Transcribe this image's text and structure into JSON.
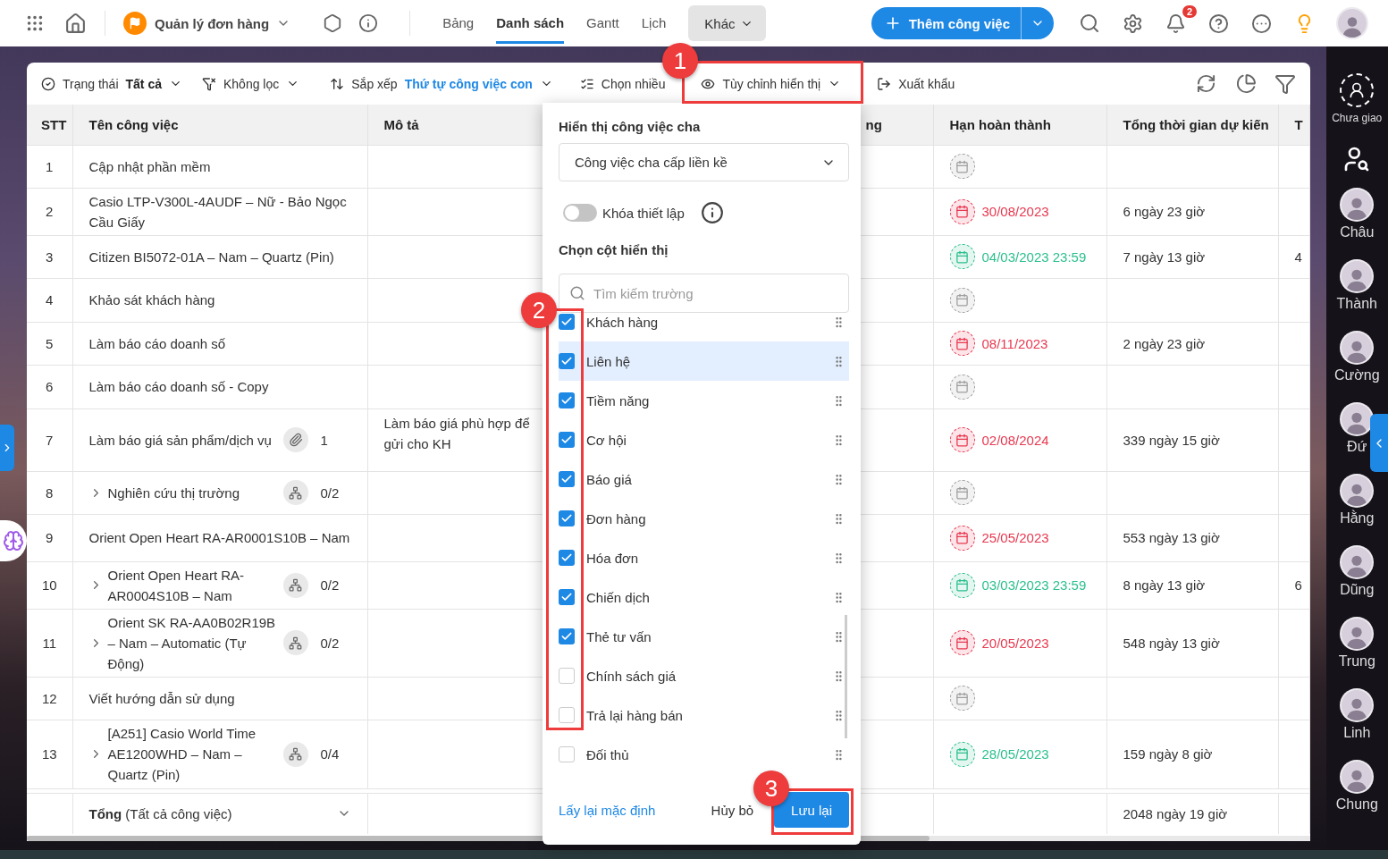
{
  "topbar": {
    "project": {
      "name": "Quản lý đơn hàng"
    },
    "views": [
      {
        "label": "Bảng",
        "selected": false
      },
      {
        "label": "Danh sách",
        "selected": true
      },
      {
        "label": "Gantt",
        "selected": false
      },
      {
        "label": "Lịch",
        "selected": false
      }
    ],
    "more_menu": {
      "label": "Khác"
    },
    "add_button": {
      "label": "Thêm công việc"
    },
    "notifications": {
      "count": "2"
    }
  },
  "toolbar": {
    "status": {
      "label": "Trạng thái",
      "value": "Tất cả"
    },
    "filter": {
      "label": "Không lọc"
    },
    "sort": {
      "label": "Sắp xếp",
      "value": "Thứ tự công việc con"
    },
    "multi_select": {
      "label": "Chọn nhiều"
    },
    "customize": {
      "label": "Tùy chỉnh hiển thị"
    },
    "export": {
      "label": "Xuất khẩu"
    }
  },
  "table": {
    "columns": [
      "STT",
      "Tên công việc",
      "Mô tả",
      "ng",
      "Hạn hoàn thành",
      "Tổng thời gian dự kiến",
      "T"
    ],
    "rows": [
      {
        "stt": "1",
        "name": "Cập nhật phần mềm",
        "expander": false,
        "deadline": {
          "color": "#9e9e9e"
        }
      },
      {
        "stt": "2",
        "name": "Casio LTP-V300L-4AUDF – Nữ  - Bảo Ngọc Cầu Giấy",
        "expander": false,
        "deadline": {
          "text": "30/08/2023",
          "color": "#e8384f"
        },
        "duration": "6 ngày 23 giờ"
      },
      {
        "stt": "3",
        "name": "Citizen BI5072-01A – Nam – Quartz (Pin)",
        "expander": false,
        "deadline": {
          "text": "04/03/2023 23:59",
          "color": "#2bbf8e"
        },
        "duration": "7 ngày 13 giờ",
        "column_7": "4"
      },
      {
        "stt": "4",
        "name": "Khảo sát khách hàng",
        "expander": false,
        "deadline": {
          "color": "#9e9e9e"
        }
      },
      {
        "stt": "5",
        "name": "Làm báo cáo doanh số",
        "expander": false,
        "deadline": {
          "text": "08/11/2023",
          "color": "#e8384f"
        },
        "duration": "2 ngày 23 giờ"
      },
      {
        "stt": "6",
        "name": "Làm báo cáo doanh số - Copy",
        "expander": false,
        "deadline": {
          "color": "#9e9e9e"
        }
      },
      {
        "stt": "7",
        "name": "Làm báo giá sản phẩm/dịch vụ",
        "expander": false,
        "badge": {
          "kind": "attachment",
          "count": "1"
        },
        "description": "Làm báo giá phù hợp để gửi cho KH",
        "deadline": {
          "text": "02/08/2024",
          "color": "#e8384f"
        },
        "duration": "339 ngày 15 giờ"
      },
      {
        "stt": "8",
        "name": "Nghiên cứu thị trường",
        "expander": true,
        "badge": {
          "kind": "subtasks",
          "count": "0/2"
        },
        "deadline": {
          "color": "#9e9e9e"
        }
      },
      {
        "stt": "9",
        "name": "Orient Open Heart RA-AR0001S10B – Nam",
        "expander": false,
        "deadline": {
          "text": "25/05/2023",
          "color": "#e8384f"
        },
        "duration": "553 ngày 13 giờ"
      },
      {
        "stt": "10",
        "name": "Orient Open Heart RA-AR0004S10B – Nam",
        "expander": true,
        "badge": {
          "kind": "subtasks",
          "count": "0/2"
        },
        "deadline": {
          "text": "03/03/2023 23:59",
          "color": "#2bbf8e"
        },
        "duration": "8 ngày 13 giờ",
        "column_7": "6"
      },
      {
        "stt": "11",
        "name": "Orient SK RA-AA0B02R19B – Nam – Automatic (Tự Động)",
        "expander": true,
        "badge": {
          "kind": "subtasks",
          "count": "0/2"
        },
        "deadline": {
          "text": "20/05/2023",
          "color": "#e8384f"
        },
        "duration": "548 ngày 13 giờ"
      },
      {
        "stt": "12",
        "name": "Viết hướng dẫn sử dụng",
        "expander": false,
        "deadline": {
          "color": "#9e9e9e"
        }
      },
      {
        "stt": "13",
        "name": "[A251] Casio World Time AE1200WHD – Nam – Quartz (Pin)",
        "expander": true,
        "badge": {
          "kind": "subtasks",
          "count": "0/4"
        },
        "deadline": {
          "text": "28/05/2023",
          "color": "#2bbf8e"
        },
        "duration": "159 ngày 8 giờ"
      }
    ],
    "total": {
      "label": "**Tổng** (Tất cả công việc)",
      "duration": "2048 ngày 19 giờ"
    }
  },
  "display_panel": {
    "parent_title": "Hiển thị công việc cha",
    "parent_value": "Công việc cha cấp liền kề",
    "lock": {
      "label": "Khóa thiết lập",
      "on": false
    },
    "columns_title": "Chọn cột hiển thị",
    "search": {
      "placeholder": "Tìm kiếm trường"
    },
    "fields": [
      {
        "label": "Khách hàng",
        "checked": true,
        "selected": false
      },
      {
        "label": "Liên hệ",
        "checked": true,
        "selected": true
      },
      {
        "label": "Tiềm năng",
        "checked": true,
        "selected": false
      },
      {
        "label": "Cơ hội",
        "checked": true,
        "selected": false
      },
      {
        "label": "Báo giá",
        "checked": true,
        "selected": false
      },
      {
        "label": "Đơn hàng",
        "checked": true,
        "selected": false
      },
      {
        "label": "Hóa đơn",
        "checked": true,
        "selected": false
      },
      {
        "label": "Chiến dịch",
        "checked": true,
        "selected": false
      },
      {
        "label": "Thẻ tư vấn",
        "checked": true,
        "selected": false
      },
      {
        "label": "Chính sách giá",
        "checked": false,
        "selected": false
      },
      {
        "label": "Trả lại hàng bán",
        "checked": false,
        "selected": false
      },
      {
        "label": "Đối thủ",
        "checked": false,
        "selected": false
      }
    ],
    "reset": "Lấy lại mặc định",
    "cancel": "Hủy bỏ",
    "save": "Lưu lại"
  },
  "members": {
    "unassigned": "Chưa giao",
    "people": [
      "Châu",
      "Thành",
      "Cường",
      "Đứ",
      "Hằng",
      "Dũng",
      "Trung",
      "Linh",
      "Chung"
    ]
  },
  "annotations": [
    {
      "number": "1"
    },
    {
      "number": "2"
    },
    {
      "number": "3"
    }
  ]
}
